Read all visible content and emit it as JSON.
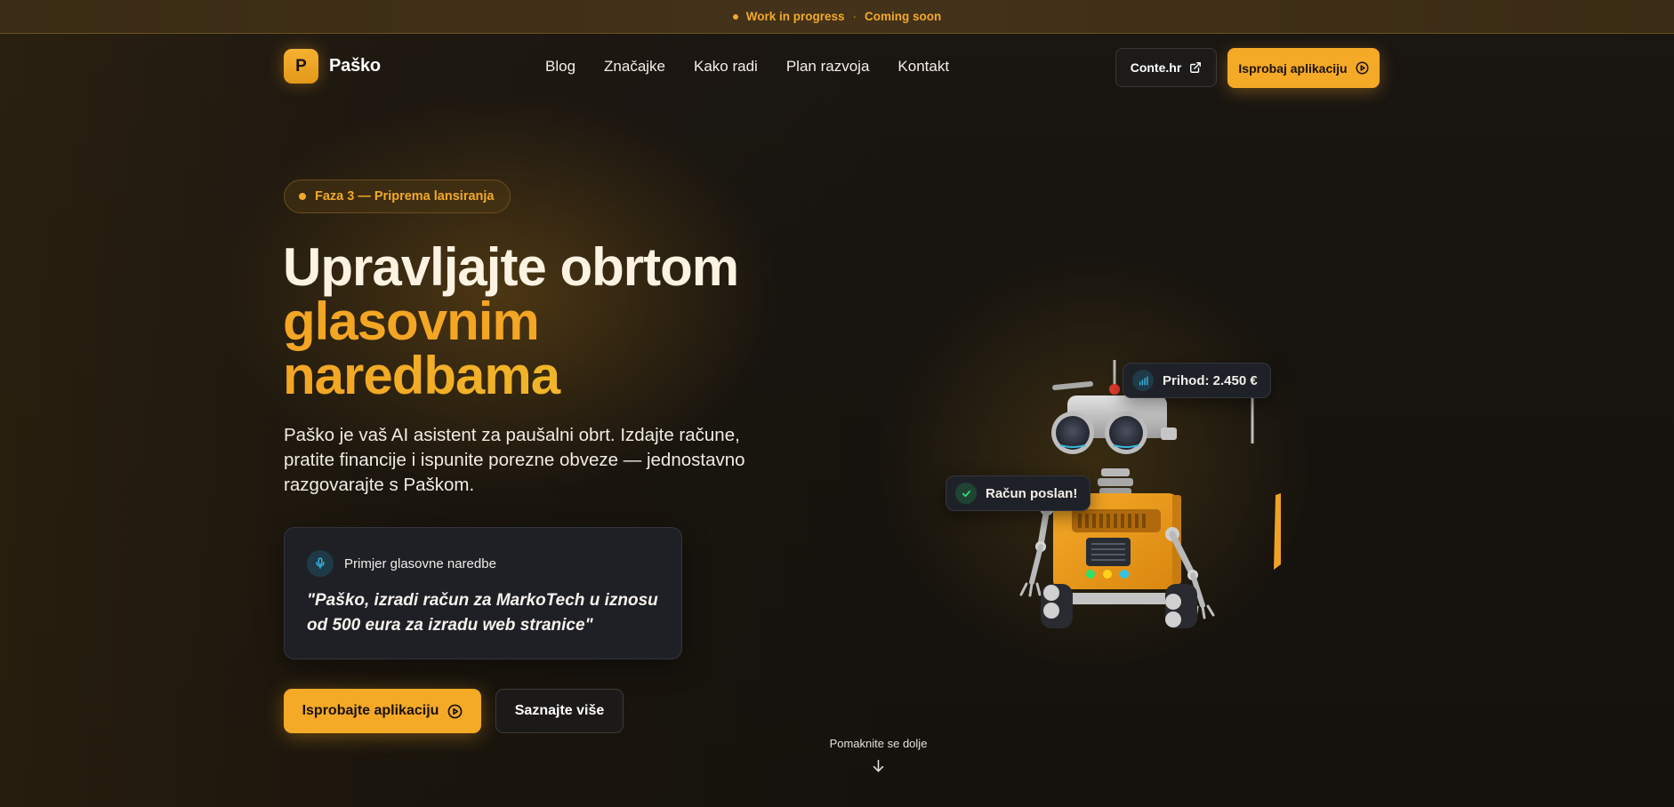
{
  "announcement": {
    "left_text": "Work in progress",
    "separator": "·",
    "right_text": "Coming soon"
  },
  "brand": {
    "logo_letter": "P",
    "name": "Paško"
  },
  "nav": {
    "items": [
      {
        "label": "Blog"
      },
      {
        "label": "Značajke"
      },
      {
        "label": "Kako radi"
      },
      {
        "label": "Plan razvoja"
      },
      {
        "label": "Kontakt"
      }
    ],
    "external_label": "Conte.hr",
    "external_icon": "external-link-icon",
    "cta_label": "Isprobaj aplikaciju",
    "cta_icon": "play-circle-icon"
  },
  "hero": {
    "phase_badge": "Faza 3 — Priprema lansiranja",
    "headline_line1": "Upravljajte obrtom",
    "headline_line2": "glasovnim",
    "headline_line3": "naredbama",
    "description": "Paško je vaš AI asistent za paušalni obrt. Izdajte račune, pratite financije i ispunite porezne obveze — jednostavno razgovarajte s Paškom.",
    "voice_card": {
      "icon": "microphone-icon",
      "title": "Primjer glasovne naredbe",
      "quote": "\"Paško, izradi račun za MarkoTech u iznosu od 500 eura za izradu web stranice\""
    },
    "primary_button": "Isprobajte aplikaciju",
    "primary_icon": "play-circle-icon",
    "secondary_button": "Saznajte više",
    "scroll_hint": "Pomaknite se dolje",
    "scroll_icon": "arrow-down-icon"
  },
  "floating_badges": {
    "income": {
      "icon": "bar-chart-icon",
      "text": "Prihod: 2.450 €"
    },
    "sent": {
      "icon": "check-icon",
      "text": "Račun poslan!"
    }
  },
  "colors": {
    "accent": "#f4a927",
    "background": "#151210",
    "card": "#1f1f26",
    "topbar_text": "#f2a92b"
  }
}
